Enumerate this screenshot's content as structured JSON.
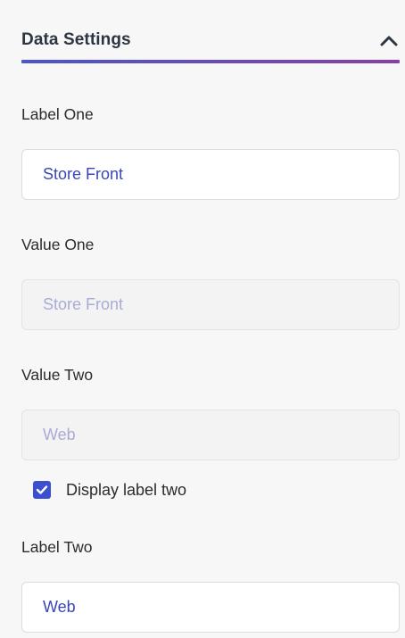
{
  "section": {
    "title": "Data Settings",
    "collapse_icon": "chevron-up-icon",
    "underline_colors": [
      "#4a56c9",
      "#8a3fa8"
    ]
  },
  "fields": {
    "label_one": {
      "label": "Label One",
      "value": "Store Front"
    },
    "value_one": {
      "label": "Value One",
      "value": "Store Front"
    },
    "value_two": {
      "label": "Value Two",
      "value": "Web"
    },
    "label_two": {
      "label": "Label Two",
      "value": "Web"
    }
  },
  "display_label_two": {
    "label": "Display label two",
    "checked": true,
    "icon": "checkmark-icon",
    "color": "#3c4fd0"
  }
}
